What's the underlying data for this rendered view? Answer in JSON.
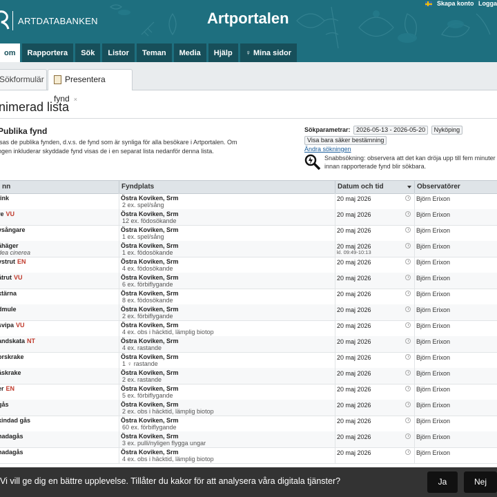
{
  "header": {
    "logo_text": "ARTDATABANKEN",
    "site_title": "Artportalen",
    "create_account": "Skapa konto",
    "login": "Logga"
  },
  "nav": [
    {
      "label": "om",
      "active": true
    },
    {
      "label": "Rapportera"
    },
    {
      "label": "Sök"
    },
    {
      "label": "Listor"
    },
    {
      "label": "Teman"
    },
    {
      "label": "Media"
    },
    {
      "label": "Hjälp"
    },
    {
      "label": "Mina sidor",
      "icon": "person-icon"
    }
  ],
  "tabs": [
    {
      "label": "Sökformulär"
    },
    {
      "label": "Presentera fynd",
      "close": "×"
    }
  ],
  "page_title": "nimerad lista",
  "section": {
    "title": "Publika fynd",
    "desc_line1": "isas de publika fynden, d.v.s. de fynd som är synliga för alla besökare i Artportalen. Om",
    "desc_line2": "ngen inkluderar skyddade fynd visas de i en separat lista nedanför denna lista."
  },
  "params": {
    "label": "Sökparametrar:",
    "date_range": "2026-05-13 - 2026-05-20",
    "location": "Nyköping",
    "certain": "Visa bara säker bestämning",
    "change_link": "Ändra sökningen"
  },
  "quick_search": {
    "text_line1": "Snabbsökning: observera att det kan dröja upp till fem minuter",
    "text_line2": "innan rapporterade fynd blir sökbara."
  },
  "columns": {
    "species": "nn",
    "site": "Fyndplats",
    "date": "Datum och tid",
    "observers": "Observatörer"
  },
  "rows": [
    {
      "species": "fink",
      "status": "",
      "latin": "",
      "site": "Östra Koviken, Srm",
      "activity": "2 ex. spel/sång",
      "date": "20 maj 2026",
      "time": "",
      "observer": "Björn Erixon"
    },
    {
      "species": "re",
      "status": "VU",
      "latin": "",
      "site": "Östra Koviken, Srm",
      "activity": "12 ex. födosökande",
      "date": "20 maj 2026",
      "time": "",
      "observer": "Björn Erixon"
    },
    {
      "species": "vsångare",
      "status": "",
      "latin": "",
      "site": "Östra Koviken, Srm",
      "activity": "1 ex. spel/sång",
      "date": "20 maj 2026",
      "time": "",
      "observer": "Björn Erixon"
    },
    {
      "species": "åhäger",
      "status": "",
      "latin": "dea cinerea",
      "site": "Östra Koviken, Srm",
      "activity": "1 ex. födosökande",
      "date": "20 maj 2026",
      "time": "kl. 09:49-10:13",
      "observer": "Björn Erixon"
    },
    {
      "species": "vstrut",
      "status": "EN",
      "latin": "",
      "site": "Östra Koviken, Srm",
      "activity": "4 ex. födosökande",
      "date": "20 maj 2026",
      "time": "",
      "observer": "Björn Erixon"
    },
    {
      "species": "åtrut",
      "status": "VU",
      "latin": "",
      "site": "Östra Koviken, Srm",
      "activity": "6 ex. förbiflygande",
      "date": "20 maj 2026",
      "time": "",
      "observer": "Björn Erixon"
    },
    {
      "species": "ktärna",
      "status": "",
      "latin": "",
      "site": "Östra Koviken, Srm",
      "activity": "8 ex. födosökande",
      "date": "20 maj 2026",
      "time": "",
      "observer": "Björn Erixon"
    },
    {
      "species": "dmule",
      "status": "",
      "latin": "",
      "site": "Östra Koviken, Srm",
      "activity": "2 ex. förbiflygande",
      "date": "20 maj 2026",
      "time": "",
      "observer": "Björn Erixon"
    },
    {
      "species": "svipa",
      "status": "VU",
      "latin": "",
      "site": "Östra Koviken, Srm",
      "activity": "4 ex. obs i häcktid, lämplig biotop",
      "date": "20 maj 2026",
      "time": "",
      "observer": "Björn Erixon"
    },
    {
      "species": "andskata",
      "status": "NT",
      "latin": "",
      "site": "Östra Koviken, Srm",
      "activity": "4 ex. rastande",
      "date": "20 maj 2026",
      "time": "",
      "observer": "Björn Erixon"
    },
    {
      "species": "orskrake",
      "status": "",
      "latin": "",
      "site": "Östra Koviken, Srm",
      "activity": "1 ♀ rastande",
      "date": "20 maj 2026",
      "time": "",
      "observer": "Björn Erixon"
    },
    {
      "species": "åskrake",
      "status": "",
      "latin": "",
      "site": "Östra Koviken, Srm",
      "activity": "2 ex. rastande",
      "date": "20 maj 2026",
      "time": "",
      "observer": "Björn Erixon"
    },
    {
      "species": "er",
      "status": "EN",
      "latin": "",
      "site": "Östra Koviken, Srm",
      "activity": "5 ex. förbiflygande",
      "date": "20 maj 2026",
      "time": "",
      "observer": "Björn Erixon"
    },
    {
      "species": "gås",
      "status": "",
      "latin": "",
      "site": "Östra Koviken, Srm",
      "activity": "2 ex. obs i häcktid, lämplig biotop",
      "date": "20 maj 2026",
      "time": "",
      "observer": "Björn Erixon"
    },
    {
      "species": "kindad gås",
      "status": "",
      "latin": "",
      "site": "Östra Koviken, Srm",
      "activity": "60 ex. förbiflygande",
      "date": "20 maj 2026",
      "time": "",
      "observer": "Björn Erixon"
    },
    {
      "species": "nadagås",
      "status": "",
      "latin": "",
      "site": "Östra Koviken, Srm",
      "activity": "3 ex. pulli/nyligen flygga ungar",
      "date": "20 maj 2026",
      "time": "",
      "observer": "Björn Erixon"
    },
    {
      "species": "nadagås",
      "status": "",
      "latin": "",
      "site": "Östra Koviken, Srm",
      "activity": "4 ex. obs i häcktid, lämplig biotop",
      "date": "20 maj 2026",
      "time": "",
      "observer": "Björn Erixon"
    }
  ],
  "cookie": {
    "text": "Vi vill ge dig en bättre upplevelse. Tillåter du kakor för att analysera våra digitala tjänster?",
    "yes": "Ja",
    "no": "Nej"
  }
}
